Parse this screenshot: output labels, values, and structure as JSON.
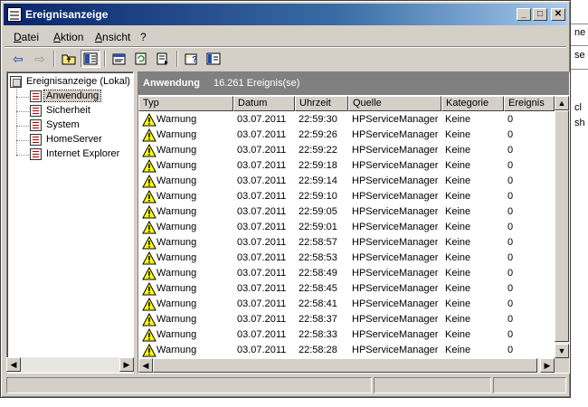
{
  "window": {
    "title": "Ereignisanzeige"
  },
  "titlebar_buttons": {
    "minimize": "_",
    "maximize": "□",
    "close": "✕"
  },
  "menu": [
    {
      "label": "Datei"
    },
    {
      "label": "Aktion"
    },
    {
      "label": "Ansicht"
    },
    {
      "label": "?"
    }
  ],
  "toolbar": {
    "icons": [
      "back-arrow-icon",
      "forward-arrow-icon",
      "up-folder-icon",
      "show-hide-tree-icon",
      "properties-icon",
      "refresh-icon",
      "export-list-icon",
      "help-icon",
      "console-icon"
    ]
  },
  "tree": {
    "root": "Ereignisanzeige (Lokal)",
    "items": [
      {
        "label": "Anwendung",
        "selected": true
      },
      {
        "label": "Sicherheit"
      },
      {
        "label": "System"
      },
      {
        "label": "HomeServer"
      },
      {
        "label": "Internet Explorer"
      }
    ]
  },
  "pane": {
    "title": "Anwendung",
    "count": "16.261 Ereignis(se)"
  },
  "columns": [
    "Typ",
    "Datum",
    "Uhrzeit",
    "Quelle",
    "Kategorie",
    "Ereignis"
  ],
  "rows": [
    {
      "typ": "Warnung",
      "datum": "03.07.2011",
      "uhrzeit": "22:59:30",
      "quelle": "HPServiceManager",
      "kategorie": "Keine",
      "ereignis": "0"
    },
    {
      "typ": "Warnung",
      "datum": "03.07.2011",
      "uhrzeit": "22:59:26",
      "quelle": "HPServiceManager",
      "kategorie": "Keine",
      "ereignis": "0"
    },
    {
      "typ": "Warnung",
      "datum": "03.07.2011",
      "uhrzeit": "22:59:22",
      "quelle": "HPServiceManager",
      "kategorie": "Keine",
      "ereignis": "0"
    },
    {
      "typ": "Warnung",
      "datum": "03.07.2011",
      "uhrzeit": "22:59:18",
      "quelle": "HPServiceManager",
      "kategorie": "Keine",
      "ereignis": "0"
    },
    {
      "typ": "Warnung",
      "datum": "03.07.2011",
      "uhrzeit": "22:59:14",
      "quelle": "HPServiceManager",
      "kategorie": "Keine",
      "ereignis": "0"
    },
    {
      "typ": "Warnung",
      "datum": "03.07.2011",
      "uhrzeit": "22:59:10",
      "quelle": "HPServiceManager",
      "kategorie": "Keine",
      "ereignis": "0"
    },
    {
      "typ": "Warnung",
      "datum": "03.07.2011",
      "uhrzeit": "22:59:05",
      "quelle": "HPServiceManager",
      "kategorie": "Keine",
      "ereignis": "0"
    },
    {
      "typ": "Warnung",
      "datum": "03.07.2011",
      "uhrzeit": "22:59:01",
      "quelle": "HPServiceManager",
      "kategorie": "Keine",
      "ereignis": "0"
    },
    {
      "typ": "Warnung",
      "datum": "03.07.2011",
      "uhrzeit": "22:58:57",
      "quelle": "HPServiceManager",
      "kategorie": "Keine",
      "ereignis": "0"
    },
    {
      "typ": "Warnung",
      "datum": "03.07.2011",
      "uhrzeit": "22:58:53",
      "quelle": "HPServiceManager",
      "kategorie": "Keine",
      "ereignis": "0"
    },
    {
      "typ": "Warnung",
      "datum": "03.07.2011",
      "uhrzeit": "22:58:49",
      "quelle": "HPServiceManager",
      "kategorie": "Keine",
      "ereignis": "0"
    },
    {
      "typ": "Warnung",
      "datum": "03.07.2011",
      "uhrzeit": "22:58:45",
      "quelle": "HPServiceManager",
      "kategorie": "Keine",
      "ereignis": "0"
    },
    {
      "typ": "Warnung",
      "datum": "03.07.2011",
      "uhrzeit": "22:58:41",
      "quelle": "HPServiceManager",
      "kategorie": "Keine",
      "ereignis": "0"
    },
    {
      "typ": "Warnung",
      "datum": "03.07.2011",
      "uhrzeit": "22:58:37",
      "quelle": "HPServiceManager",
      "kategorie": "Keine",
      "ereignis": "0"
    },
    {
      "typ": "Warnung",
      "datum": "03.07.2011",
      "uhrzeit": "22:58:33",
      "quelle": "HPServiceManager",
      "kategorie": "Keine",
      "ereignis": "0"
    },
    {
      "typ": "Warnung",
      "datum": "03.07.2011",
      "uhrzeit": "22:58:28",
      "quelle": "HPServiceManager",
      "kategorie": "Keine",
      "ereignis": "0"
    }
  ],
  "backdrop_fragments": [
    "ne",
    "se",
    "cl",
    "sh"
  ],
  "colors": {
    "title_start": "#0a246a",
    "title_end": "#a6caf0",
    "face": "#d4d0c8",
    "header_gray": "#808080",
    "warning_yellow": "#ffff00"
  }
}
